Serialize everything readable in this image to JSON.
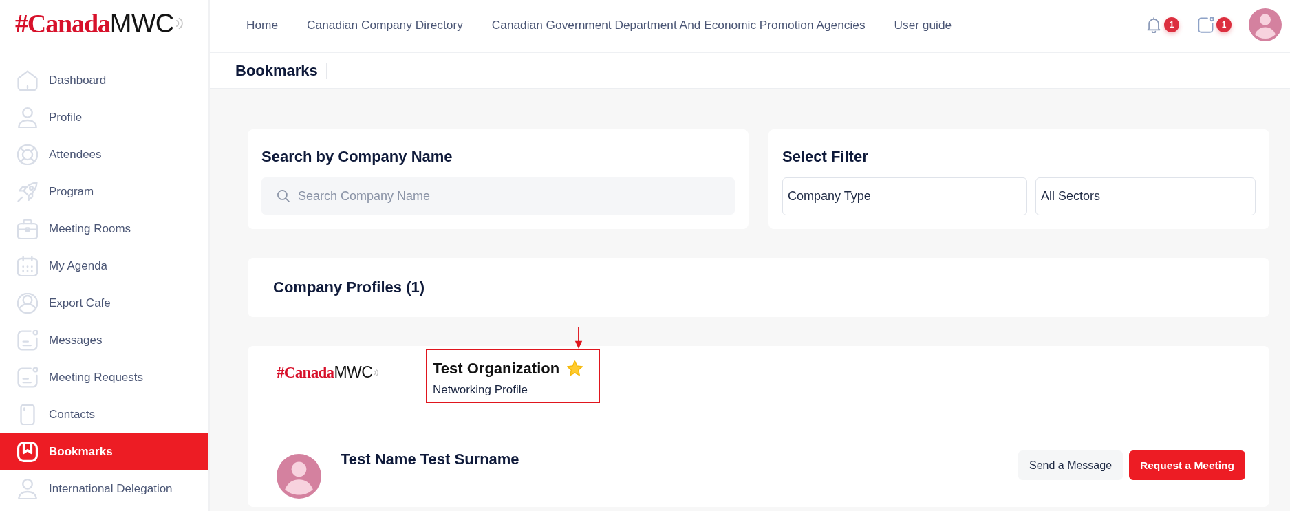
{
  "logo": {
    "brand": "#Canada",
    "suffix": "MWC"
  },
  "sidebar": {
    "items": [
      {
        "label": "Dashboard",
        "selected": false
      },
      {
        "label": "Profile",
        "selected": false
      },
      {
        "label": "Attendees",
        "selected": false
      },
      {
        "label": "Program",
        "selected": false
      },
      {
        "label": "Meeting Rooms",
        "selected": false
      },
      {
        "label": "My Agenda",
        "selected": false
      },
      {
        "label": "Export Cafe",
        "selected": false
      },
      {
        "label": "Messages",
        "selected": false
      },
      {
        "label": "Meeting Requests",
        "selected": false
      },
      {
        "label": "Contacts",
        "selected": false
      },
      {
        "label": "Bookmarks",
        "selected": true
      },
      {
        "label": "International Delegation",
        "selected": false
      }
    ]
  },
  "top_nav": {
    "links": [
      {
        "label": "Home"
      },
      {
        "label": "Canadian Company Directory"
      },
      {
        "label": "Canadian Government Department And Economic Promotion Agencies"
      },
      {
        "label": "User guide"
      }
    ],
    "notifications": {
      "count": "1"
    },
    "messages": {
      "count": "1"
    }
  },
  "page_header": {
    "title": "Bookmarks"
  },
  "search_panel": {
    "title": "Search by Company Name",
    "search": {
      "placeholder": "Search Company Name"
    }
  },
  "filter_panel": {
    "title": "Select Filter",
    "selects": [
      {
        "value": "Company Type"
      },
      {
        "value": "All Sectors"
      }
    ]
  },
  "results": {
    "title": "Company Profiles (1)"
  },
  "company_card": {
    "logo": {
      "brand": "#Canada",
      "suffix": "MWC"
    },
    "name": "Test Organization",
    "starred": true,
    "highlighted": true,
    "subtitle": "Networking Profile",
    "contact": {
      "name": "Test Name Test Surname"
    },
    "actions": [
      {
        "label": "Send a Message",
        "kind": "secondary"
      },
      {
        "label": "Request a Meeting",
        "kind": "primary"
      }
    ]
  }
}
